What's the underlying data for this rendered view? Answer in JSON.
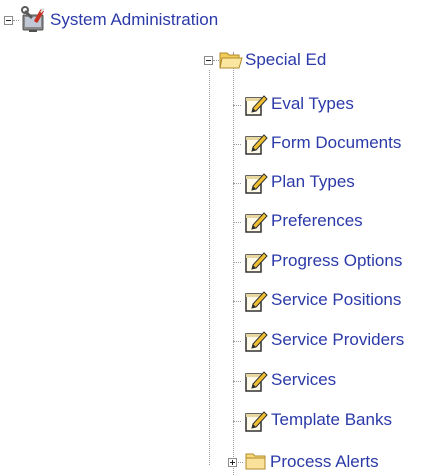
{
  "colors": {
    "link": "#2b3aa8",
    "tree_line": "#9a9a9a",
    "folder": "#f7d978",
    "folder_dark": "#c9a23a"
  },
  "tree": {
    "root": {
      "label": "System Administration",
      "icon": "admin-tools-icon",
      "expanded": true
    },
    "special_ed": {
      "label": "Special Ed",
      "icon": "folder-open-icon",
      "expanded": true,
      "children": [
        {
          "label": "Eval Types",
          "icon": "edit-document-icon"
        },
        {
          "label": "Form Documents",
          "icon": "edit-document-icon"
        },
        {
          "label": "Plan Types",
          "icon": "edit-document-icon"
        },
        {
          "label": "Preferences",
          "icon": "edit-document-icon"
        },
        {
          "label": "Progress Options",
          "icon": "edit-document-icon"
        },
        {
          "label": "Service Positions",
          "icon": "edit-document-icon"
        },
        {
          "label": "Service Providers",
          "icon": "edit-document-icon"
        },
        {
          "label": "Services",
          "icon": "edit-document-icon"
        },
        {
          "label": "Template Banks",
          "icon": "edit-document-icon"
        }
      ]
    },
    "process_alerts": {
      "label": "Process Alerts",
      "icon": "folder-closed-icon",
      "expanded": false
    }
  }
}
